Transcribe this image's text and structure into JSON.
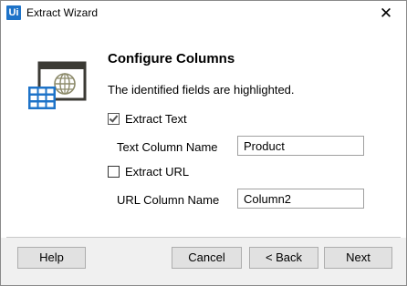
{
  "window": {
    "title": "Extract Wizard",
    "app_icon_text": "Ui",
    "close_glyph": "✕"
  },
  "page": {
    "title": "Configure Columns",
    "description": "The identified fields are highlighted."
  },
  "fields": {
    "extract_text": {
      "label": "Extract Text",
      "checked": true
    },
    "text_column": {
      "label": "Text Column Name",
      "value": "Product"
    },
    "extract_url": {
      "label": "Extract URL",
      "checked": false
    },
    "url_column": {
      "label": "URL Column Name",
      "value": "Column2"
    }
  },
  "buttons": {
    "help": "Help",
    "cancel": "Cancel",
    "back": "< Back",
    "next": "Next"
  },
  "colors": {
    "accent": "#1e73c8",
    "icon_dark": "#3b3a34",
    "icon_olive": "#8c8a6a",
    "footer_bg": "#f0f0f0"
  },
  "icons": {
    "wizard": "web-table-extract-icon",
    "app": "uipath-icon"
  }
}
